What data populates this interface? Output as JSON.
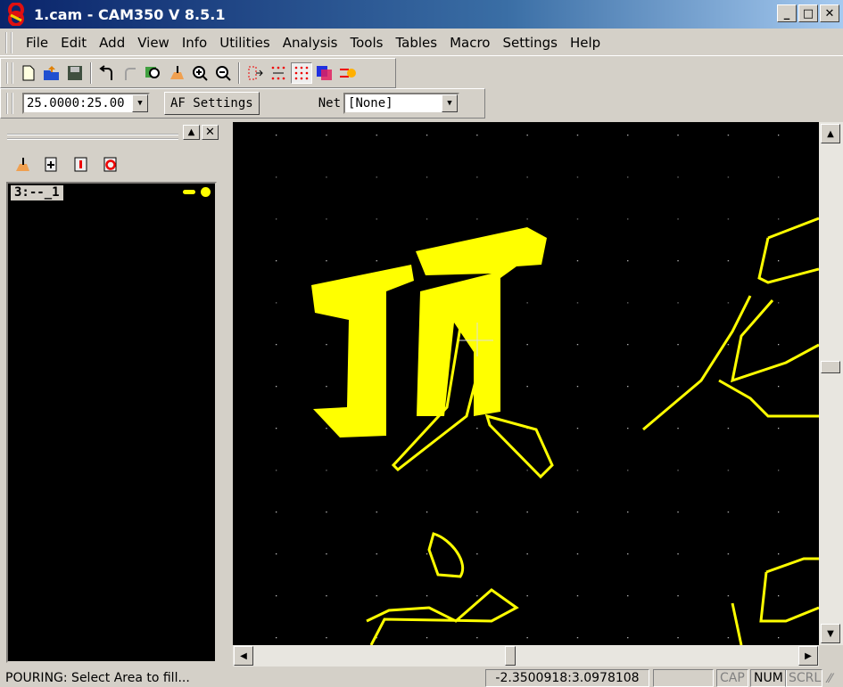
{
  "title": "1.cam - CAM350 V 8.5.1",
  "menu": [
    "File",
    "Edit",
    "Add",
    "View",
    "Info",
    "Utilities",
    "Analysis",
    "Tools",
    "Tables",
    "Macro",
    "Settings",
    "Help"
  ],
  "toolbar2": {
    "grid_value": "25.0000:25.00",
    "af_settings": "AF Settings",
    "net_label": "Net",
    "net_value": "[None]"
  },
  "layers": {
    "active_layer": "3:--_1"
  },
  "colors": {
    "layer": "#ffff00",
    "canvas": "#000000"
  },
  "status": {
    "message": "POURING: Select Area to fill...",
    "coords": "-2.3500918:3.0978108",
    "cap": "CAP",
    "num": "NUM",
    "scrl": "SCRL"
  }
}
